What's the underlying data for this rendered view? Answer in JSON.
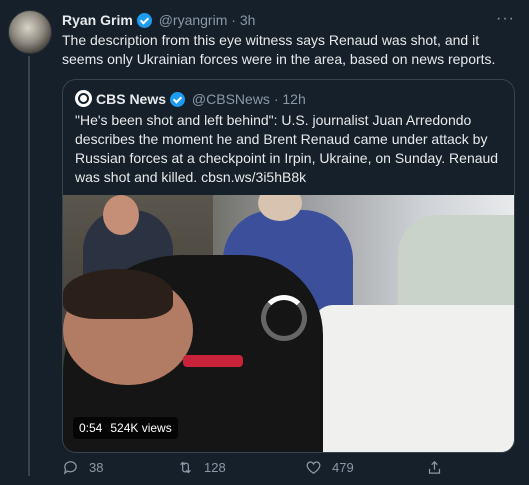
{
  "tweet": {
    "author_name": "Ryan Grim",
    "handle": "@ryangrim",
    "separator": "·",
    "time": "3h",
    "text": "The description from this eye witness says Renaud was shot, and it seems only Ukrainian forces were in the area, based on news reports.",
    "more_label": "···"
  },
  "quoted": {
    "author_name": "CBS News",
    "handle": "@CBSNews",
    "separator": "·",
    "time": "12h",
    "text": "\"He's been shot and left behind\": U.S. journalist Juan Arredondo describes the moment he and Brent Renaud came under attack by Russian forces at a checkpoint in Irpin, Ukraine, on Sunday. Renaud was shot and killed. cbsn.ws/3i5hB8k",
    "video": {
      "duration": "0:54",
      "views": "524K views"
    }
  },
  "actions": {
    "replies": "38",
    "retweets": "128",
    "likes": "479"
  },
  "icons": [
    "verified-icon",
    "more-icon",
    "reply-icon",
    "retweet-icon",
    "like-icon",
    "share-icon",
    "loading-spinner-icon"
  ],
  "colors": {
    "background": "#15202b",
    "accent": "#1d9bf0",
    "muted": "#8b98a5",
    "text": "#e7e9ea"
  }
}
